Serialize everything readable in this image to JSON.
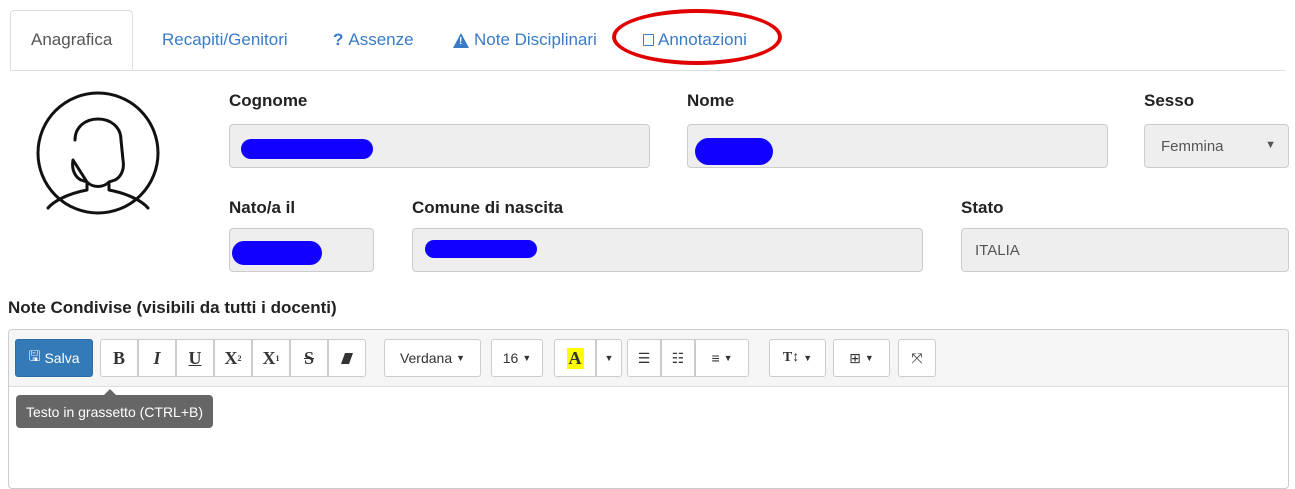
{
  "tabs": [
    {
      "label": "Anagrafica",
      "icon": ""
    },
    {
      "label": "Recapiti/Genitori",
      "icon": ""
    },
    {
      "label": "Assenze",
      "icon": "?"
    },
    {
      "label": "Note Disciplinari",
      "icon": "warning-icon"
    },
    {
      "label": "Annotazioni",
      "icon": "note-icon"
    }
  ],
  "form": {
    "cognome_label": "Cognome",
    "nome_label": "Nome",
    "sesso_label": "Sesso",
    "sesso_value": "Femmina",
    "nato_label": "Nato/a il",
    "comune_label": "Comune di nascita",
    "stato_label": "Stato",
    "stato_value": "ITALIA"
  },
  "notes": {
    "title": "Note Condivise (visibili da tutti i docenti)"
  },
  "toolbar": {
    "save_label": "Salva",
    "bold": "B",
    "italic": "I",
    "underline": "U",
    "superscript": "X",
    "subscript": "X",
    "strikethrough": "S",
    "font_family": "Verdana",
    "font_size": "16",
    "tooltip": "Testo in grassetto (CTRL+B)"
  },
  "colors": {
    "link": "#3a7bc8",
    "save_button": "#337ab7",
    "highlight_ring": "#e00000",
    "redaction": "#1100ff"
  }
}
